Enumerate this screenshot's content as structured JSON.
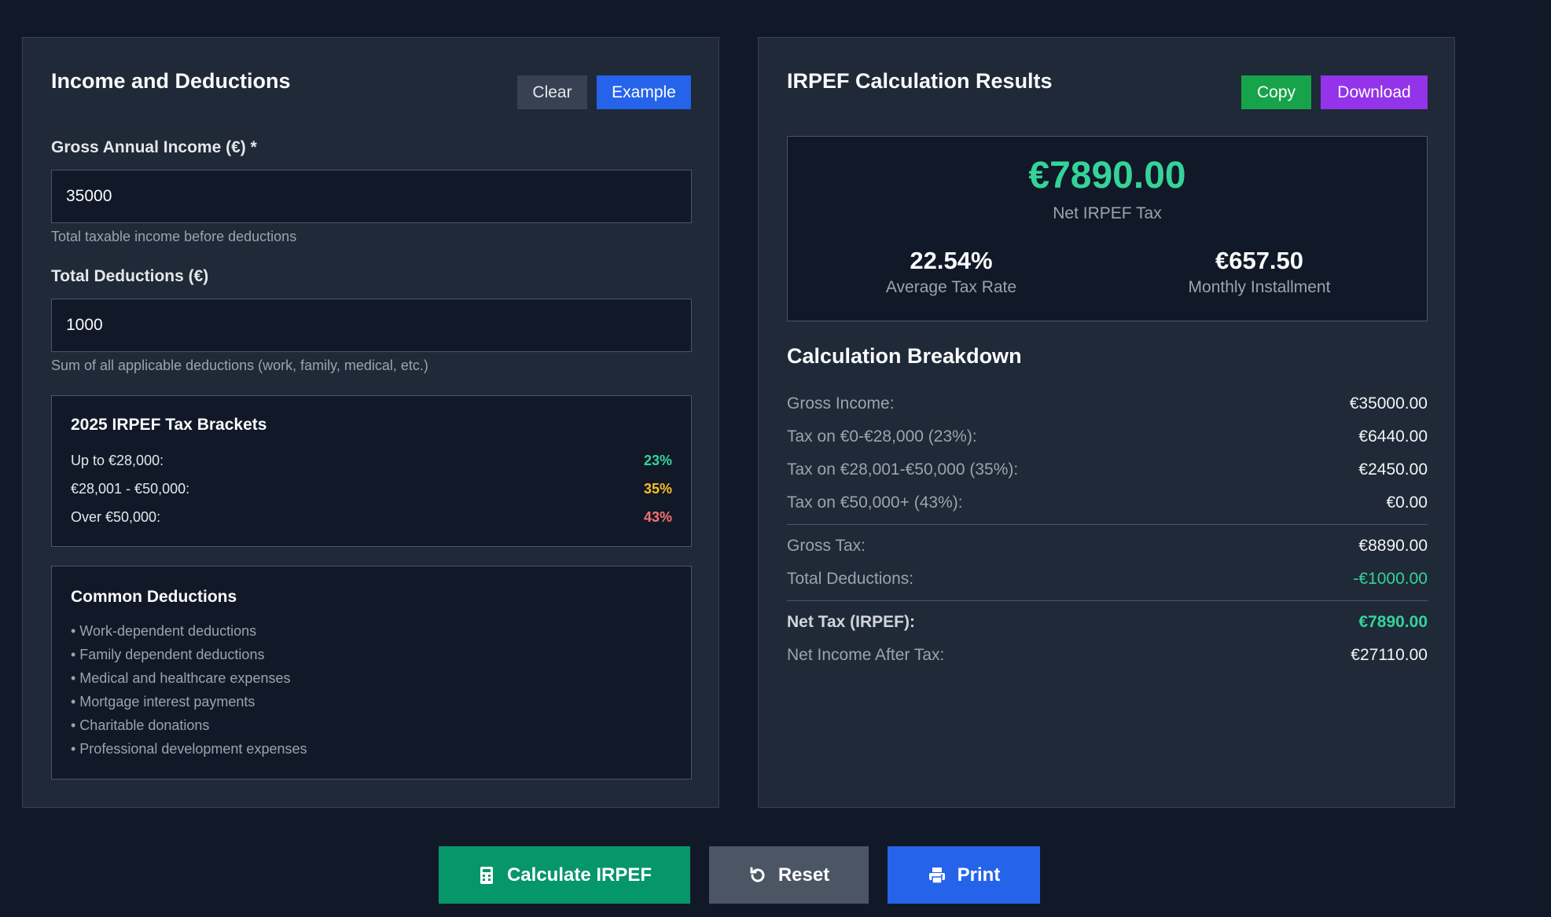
{
  "input_panel": {
    "title": "Income and Deductions",
    "clear_label": "Clear",
    "example_label": "Example",
    "gross_income": {
      "label": "Gross Annual Income (€) *",
      "value": "35000",
      "hint": "Total taxable income before deductions"
    },
    "deductions": {
      "label": "Total Deductions (€)",
      "value": "1000",
      "hint": "Sum of all applicable deductions (work, family, medical, etc.)"
    },
    "brackets": {
      "title": "2025 IRPEF Tax Brackets",
      "rows": [
        {
          "label": "Up to €28,000:",
          "rate": "23%",
          "color": "#34d399"
        },
        {
          "label": "€28,001 - €50,000:",
          "rate": "35%",
          "color": "#fbbf24"
        },
        {
          "label": "Over €50,000:",
          "rate": "43%",
          "color": "#f87171"
        }
      ]
    },
    "common_deductions": {
      "title": "Common Deductions",
      "items": [
        "• Work-dependent deductions",
        "• Family dependent deductions",
        "• Medical and healthcare expenses",
        "• Mortgage interest payments",
        "• Charitable donations",
        "• Professional development expenses"
      ]
    }
  },
  "results_panel": {
    "title": "IRPEF Calculation Results",
    "copy_label": "Copy",
    "download_label": "Download",
    "net_tax_value": "€7890.00",
    "net_tax_label": "Net IRPEF Tax",
    "average_rate_value": "22.54%",
    "average_rate_label": "Average Tax Rate",
    "monthly_value": "€657.50",
    "monthly_label": "Monthly Installment",
    "breakdown_title": "Calculation Breakdown",
    "breakdown": [
      {
        "key": "Gross Income:",
        "value": "€35000.00"
      },
      {
        "key": "Tax on €0-€28,000 (23%):",
        "value": "€6440.00"
      },
      {
        "key": "Tax on €28,001-€50,000 (35%):",
        "value": "€2450.00"
      },
      {
        "key": "Tax on €50,000+ (43%):",
        "value": "€0.00"
      },
      {
        "key": "Gross Tax:",
        "value": "€8890.00"
      },
      {
        "key": "Total Deductions:",
        "value": "-€1000.00"
      },
      {
        "key": "Net Tax (IRPEF):",
        "value": "€7890.00"
      },
      {
        "key": "Net Income After Tax:",
        "value": "€27110.00"
      }
    ]
  },
  "actions": {
    "calculate_label": "Calculate IRPEF",
    "calculate_icon": "calculator-icon",
    "reset_label": "Reset",
    "reset_icon": "reset-icon",
    "print_label": "Print",
    "print_icon": "printer-icon"
  },
  "colors": {
    "background": "#111827",
    "panel": "#1f2937",
    "accent_green": "#34d399",
    "accent_blue": "#2563eb",
    "accent_purple": "#9333ea"
  }
}
